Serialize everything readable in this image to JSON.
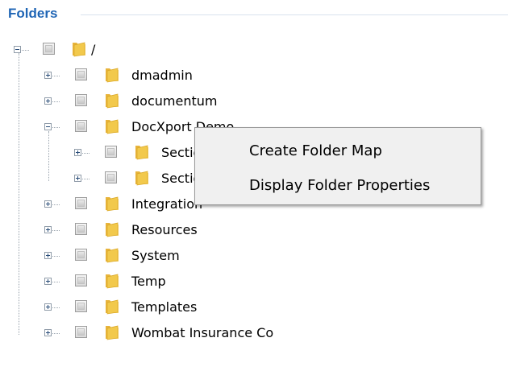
{
  "panel": {
    "title": "Folders"
  },
  "tree": {
    "root": {
      "label": "/"
    },
    "items": [
      {
        "label": "dmadmin"
      },
      {
        "label": "documentum"
      },
      {
        "label": "DocXport Demo"
      },
      {
        "label": "Section 1"
      },
      {
        "label": "Section 2"
      },
      {
        "label": "Integration"
      },
      {
        "label": "Resources"
      },
      {
        "label": "System"
      },
      {
        "label": "Temp"
      },
      {
        "label": "Templates"
      },
      {
        "label": "Wombat Insurance Co"
      }
    ]
  },
  "context_menu": {
    "items": [
      {
        "label": "Create Folder Map"
      },
      {
        "label": "Display Folder Properties"
      }
    ]
  },
  "colors": {
    "legend": "#1f65b5",
    "menu_bg": "#f0f0f0",
    "folder": "#f2c94c"
  }
}
